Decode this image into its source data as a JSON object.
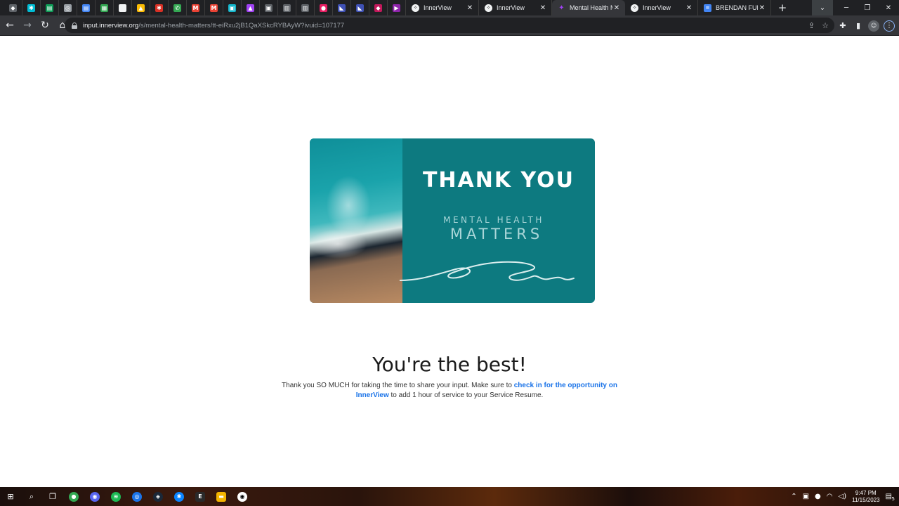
{
  "browser": {
    "pinned_tabs": [
      {
        "icon": "puzzle-extension-icon",
        "color": "#5f6368",
        "glyph": "◆"
      },
      {
        "icon": "network-icon",
        "color": "#00bcd4",
        "glyph": "✱"
      },
      {
        "icon": "sheets-icon",
        "color": "#0f9d58",
        "glyph": "▤"
      },
      {
        "icon": "chrome-settings-icon",
        "color": "#9aa0a6",
        "glyph": "◎"
      },
      {
        "icon": "docs-icon",
        "color": "#4285f4",
        "glyph": "▤"
      },
      {
        "icon": "calculator-icon",
        "color": "#34a853",
        "glyph": "▦"
      },
      {
        "icon": "blank-page-icon",
        "color": "#f1f3f4",
        "glyph": ""
      },
      {
        "icon": "drive-icon",
        "color": "#fbbc04",
        "glyph": "▲"
      },
      {
        "icon": "red-app-icon",
        "color": "#d93025",
        "glyph": "✱"
      },
      {
        "icon": "phone-icon",
        "color": "#34a853",
        "glyph": "✆"
      },
      {
        "icon": "gmail-icon",
        "color": "#ea4335",
        "glyph": "M"
      },
      {
        "icon": "gmail-icon",
        "color": "#ea4335",
        "glyph": "M"
      },
      {
        "icon": "classroom-icon",
        "color": "#12b5cb",
        "glyph": "▣"
      },
      {
        "icon": "purple-app-icon",
        "color": "#a142f4",
        "glyph": "▲"
      },
      {
        "icon": "image-icon",
        "color": "#5f6368",
        "glyph": "▣"
      },
      {
        "icon": "library-icon",
        "color": "#5f6368",
        "glyph": "▥"
      },
      {
        "icon": "library-icon",
        "color": "#5f6368",
        "glyph": "▥"
      },
      {
        "icon": "pink-app-icon",
        "color": "#e91e63",
        "glyph": "●"
      },
      {
        "icon": "bird-icon",
        "color": "#3f51b5",
        "glyph": "◣"
      },
      {
        "icon": "bird-icon",
        "color": "#3f51b5",
        "glyph": "◣"
      },
      {
        "icon": "shield-icon",
        "color": "#c2185b",
        "glyph": "◆"
      },
      {
        "icon": "play-icon",
        "color": "#8e24aa",
        "glyph": "▶"
      }
    ],
    "tabs": [
      {
        "title": "InnerView",
        "icon": "innerview-icon",
        "active": false
      },
      {
        "title": "InnerView",
        "icon": "innerview-icon",
        "active": false
      },
      {
        "title": "Mental Health M",
        "icon": "innerview-purple-icon",
        "active": true
      },
      {
        "title": "InnerView",
        "icon": "innerview-icon",
        "active": false
      },
      {
        "title": "BRENDAN FURU",
        "icon": "docs-icon",
        "active": false
      }
    ],
    "url_host": "input.innerview.org",
    "url_path": "/s/mental-health-matters/tt-eiRxu2jB1QaXSkcRYBAyW?ivuid=107177"
  },
  "card": {
    "title": "THANK YOU",
    "subtitle_line1": "MENTAL HEALTH",
    "subtitle_line2": "MATTERS",
    "background_color": "#0d7a80"
  },
  "headline": "You're the best!",
  "message": {
    "before": "Thank you SO MUCH for taking the time to share your input. Make sure to ",
    "link": "check in for the opportunity on InnerView",
    "after": " to add 1 hour of service to your Service Resume."
  },
  "taskbar": {
    "time": "9:47 PM",
    "date": "11/15/2023",
    "notification_count": "5"
  }
}
